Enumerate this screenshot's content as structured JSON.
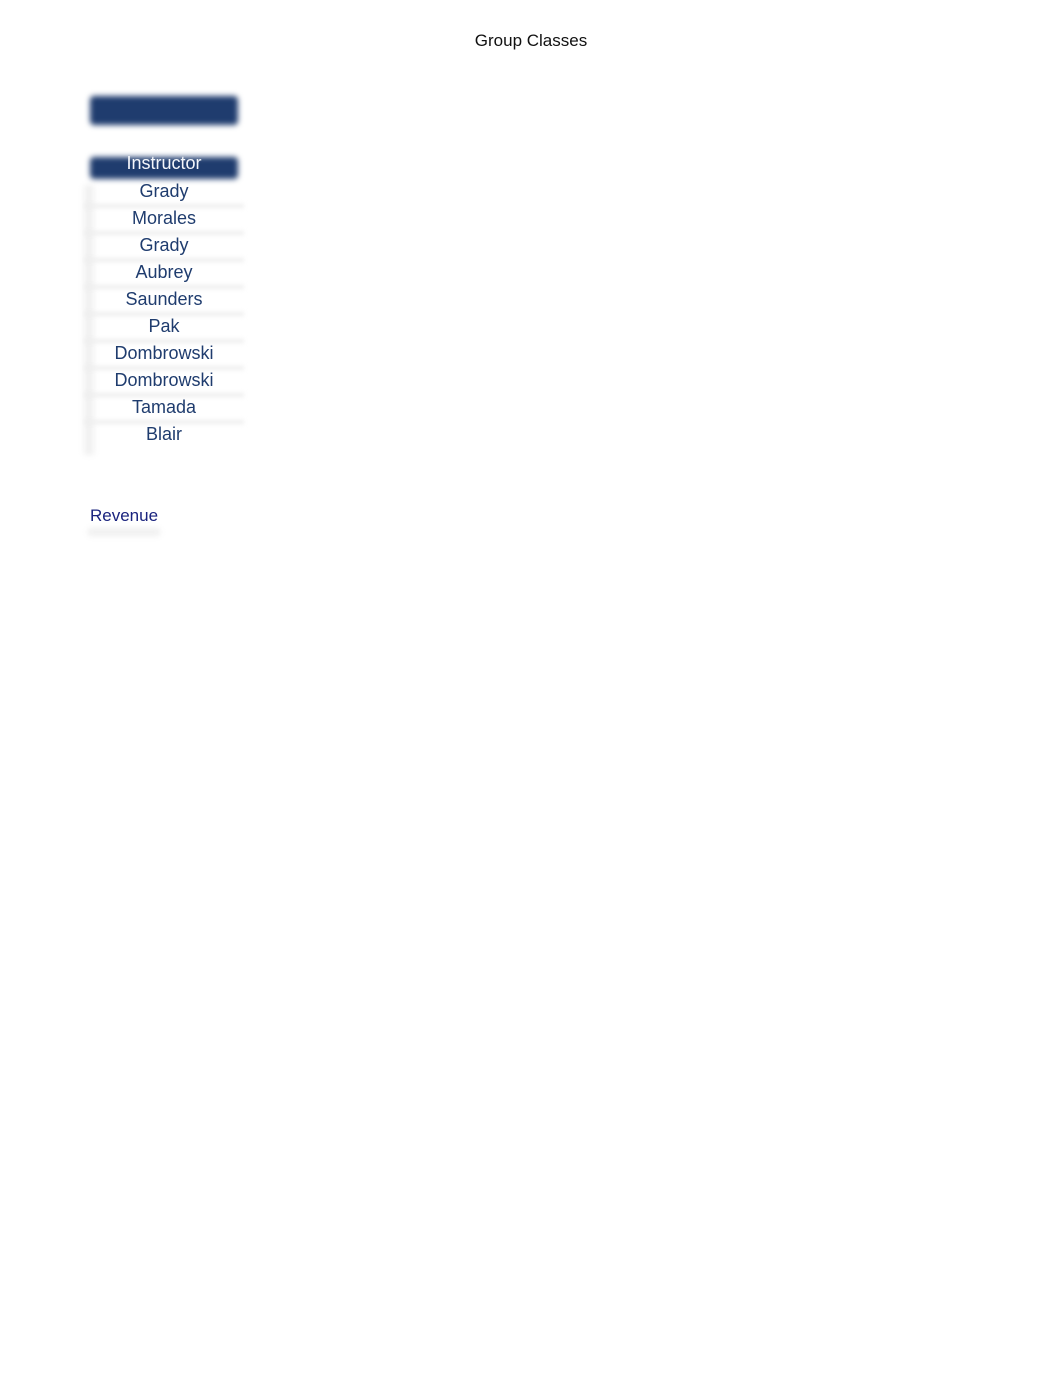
{
  "document": {
    "title": "Group Classes"
  },
  "table": {
    "column_header": "Instructor",
    "instructors": [
      "Grady",
      "Morales",
      "Grady",
      "Aubrey",
      "Saunders",
      "Pak",
      "Dombrowski",
      "Dombrowski",
      "Tamada",
      "Blair"
    ]
  },
  "sections": {
    "revenue_label": "Revenue"
  },
  "colors": {
    "header_bar": "#1f3c6e",
    "instructor_text": "#1f3c6e",
    "revenue_text": "#1a237e"
  }
}
